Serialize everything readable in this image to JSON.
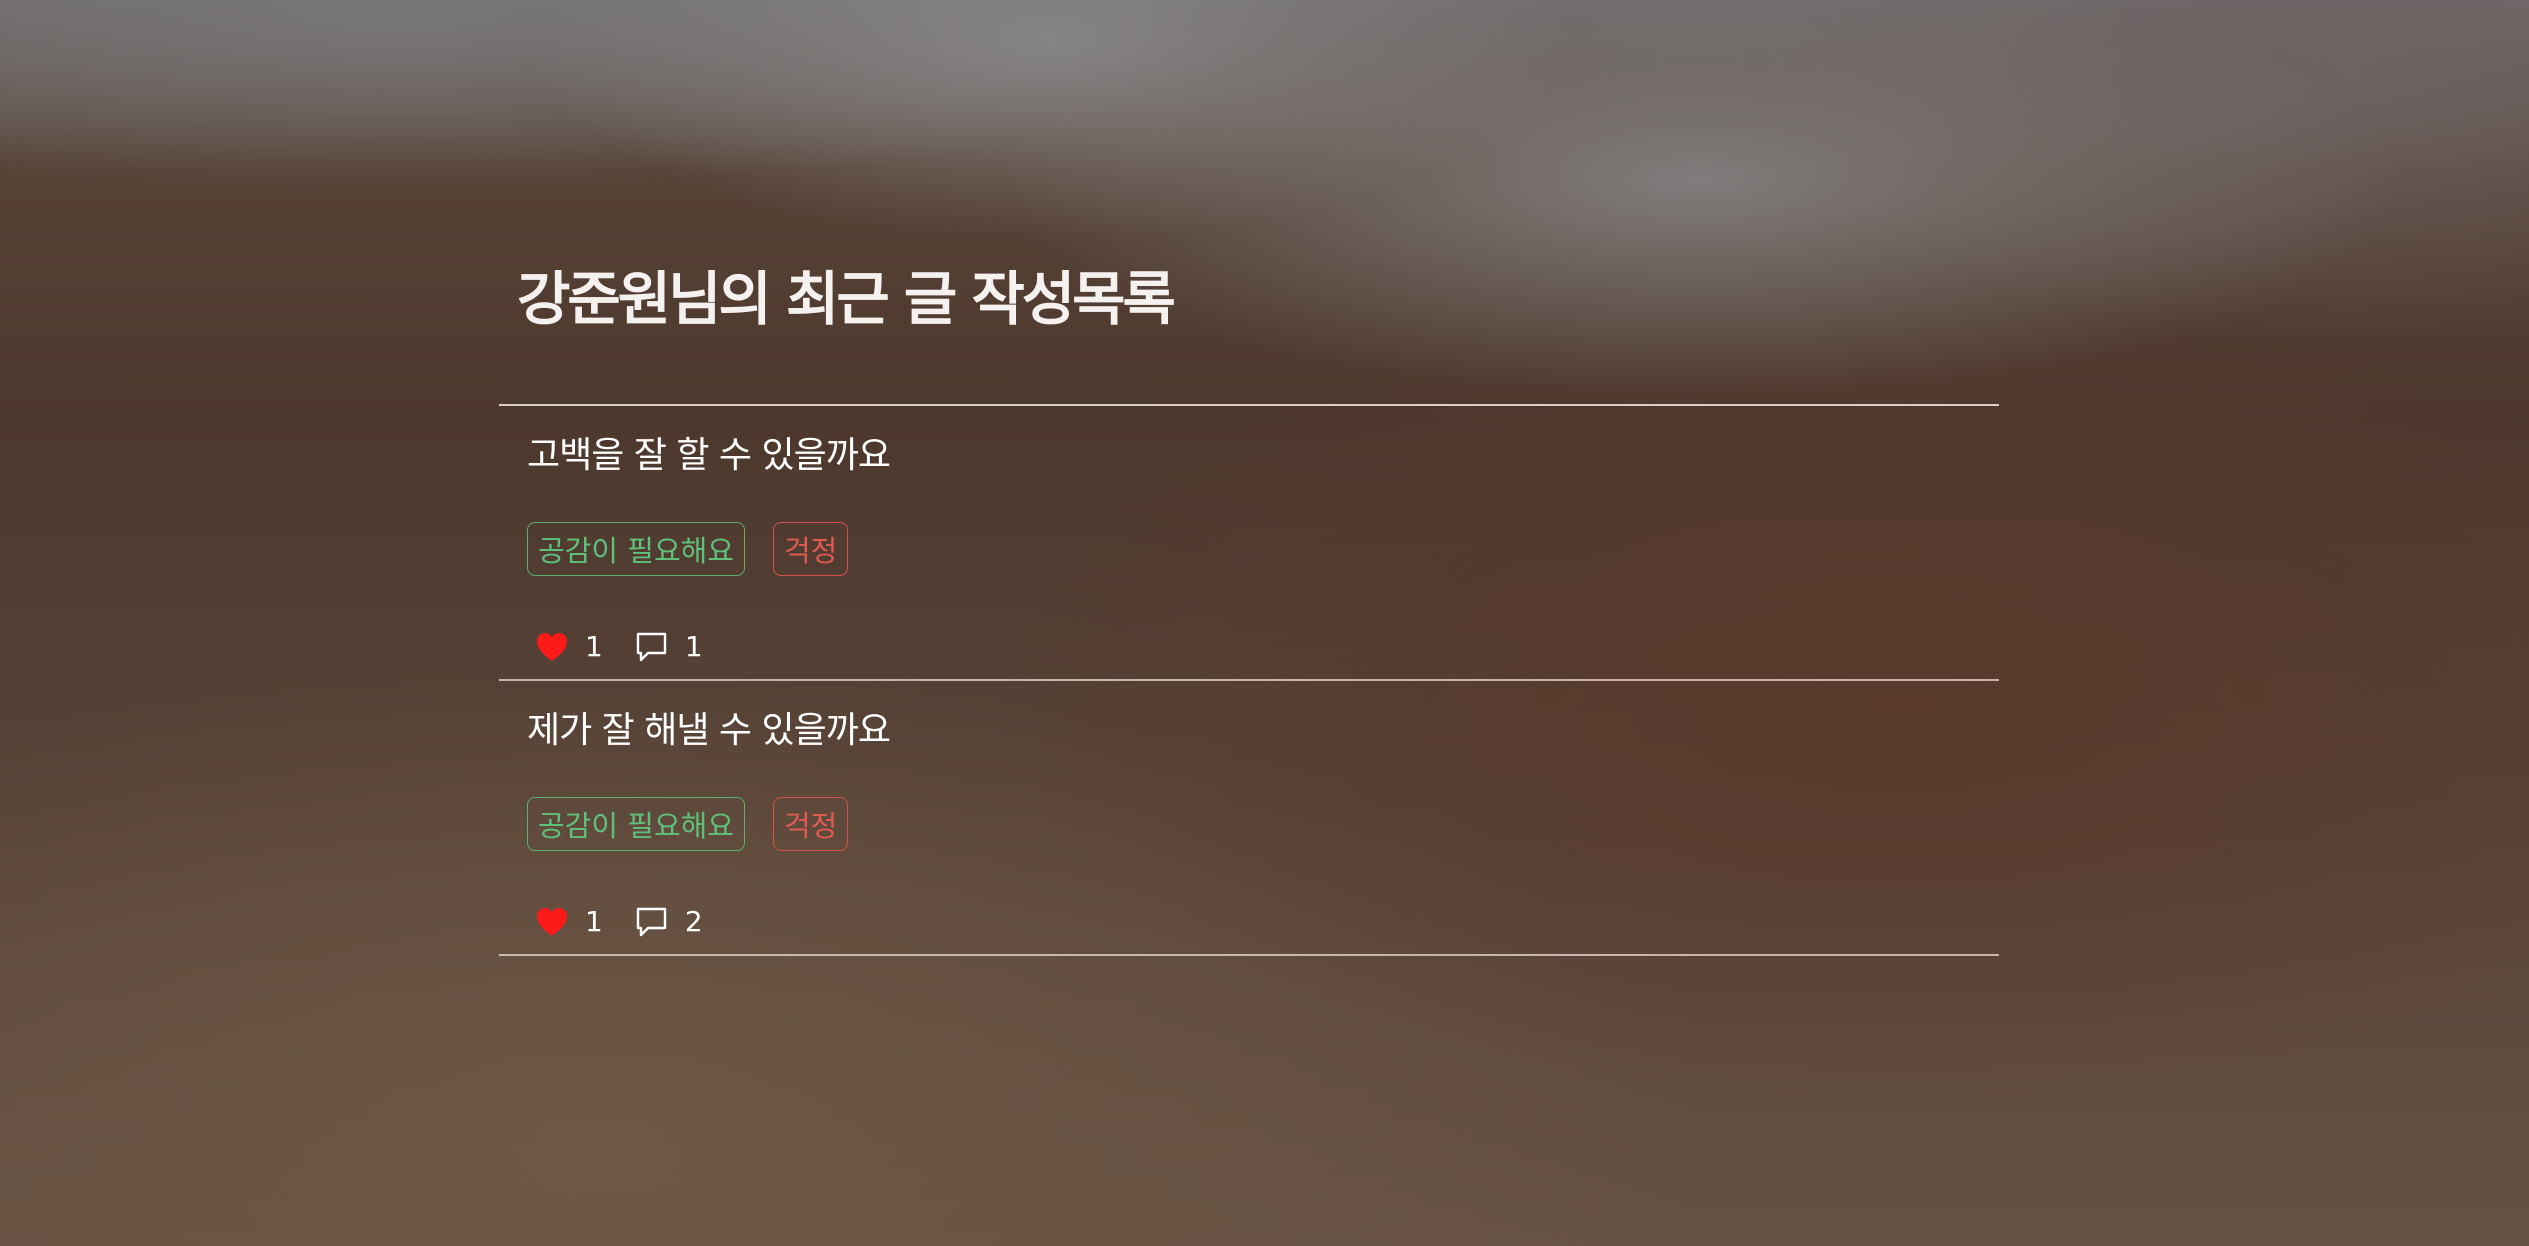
{
  "page": {
    "title": "강준원님의 최근 글 작성목록"
  },
  "colors": {
    "like_heart": "#ff1a1a",
    "tag_green": "#5fc07a",
    "tag_red": "#e05a52"
  },
  "posts": [
    {
      "title": "고백을 잘 할 수 있을까요",
      "tags": [
        {
          "label": "공감이 필요해요",
          "color": "green"
        },
        {
          "label": "걱정",
          "color": "red"
        }
      ],
      "likes": "1",
      "comments": "1"
    },
    {
      "title": "제가 잘 해낼 수 있을까요",
      "tags": [
        {
          "label": "공감이 필요해요",
          "color": "green"
        },
        {
          "label": "걱정",
          "color": "red"
        }
      ],
      "likes": "1",
      "comments": "2"
    }
  ],
  "icons": {
    "like": "heart-icon",
    "comment": "speech-bubble-icon"
  }
}
